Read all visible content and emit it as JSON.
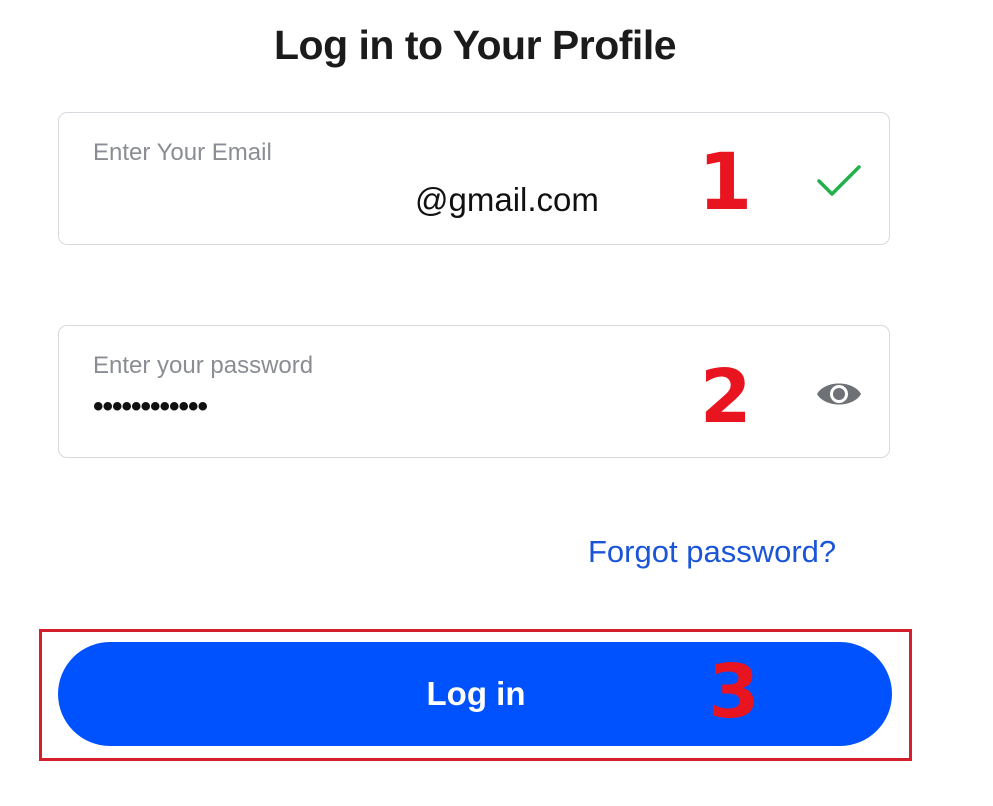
{
  "page": {
    "title": "Log in to Your Profile"
  },
  "email_field": {
    "label": "Enter Your Email",
    "value": "@gmail.com",
    "status_icon": "checkmark-icon",
    "status_color": "#22b14c"
  },
  "password_field": {
    "label": "Enter your password",
    "value": "••••••••••••",
    "toggle_icon": "eye-icon"
  },
  "links": {
    "forgot_password": "Forgot password?"
  },
  "actions": {
    "login_label": "Log in"
  },
  "annotations": {
    "step1": "1",
    "step2": "2",
    "step3": "3",
    "color": "#e8141f"
  },
  "colors": {
    "primary": "#0052ff",
    "link": "#1a55d8",
    "highlight_border": "#d4202c"
  }
}
